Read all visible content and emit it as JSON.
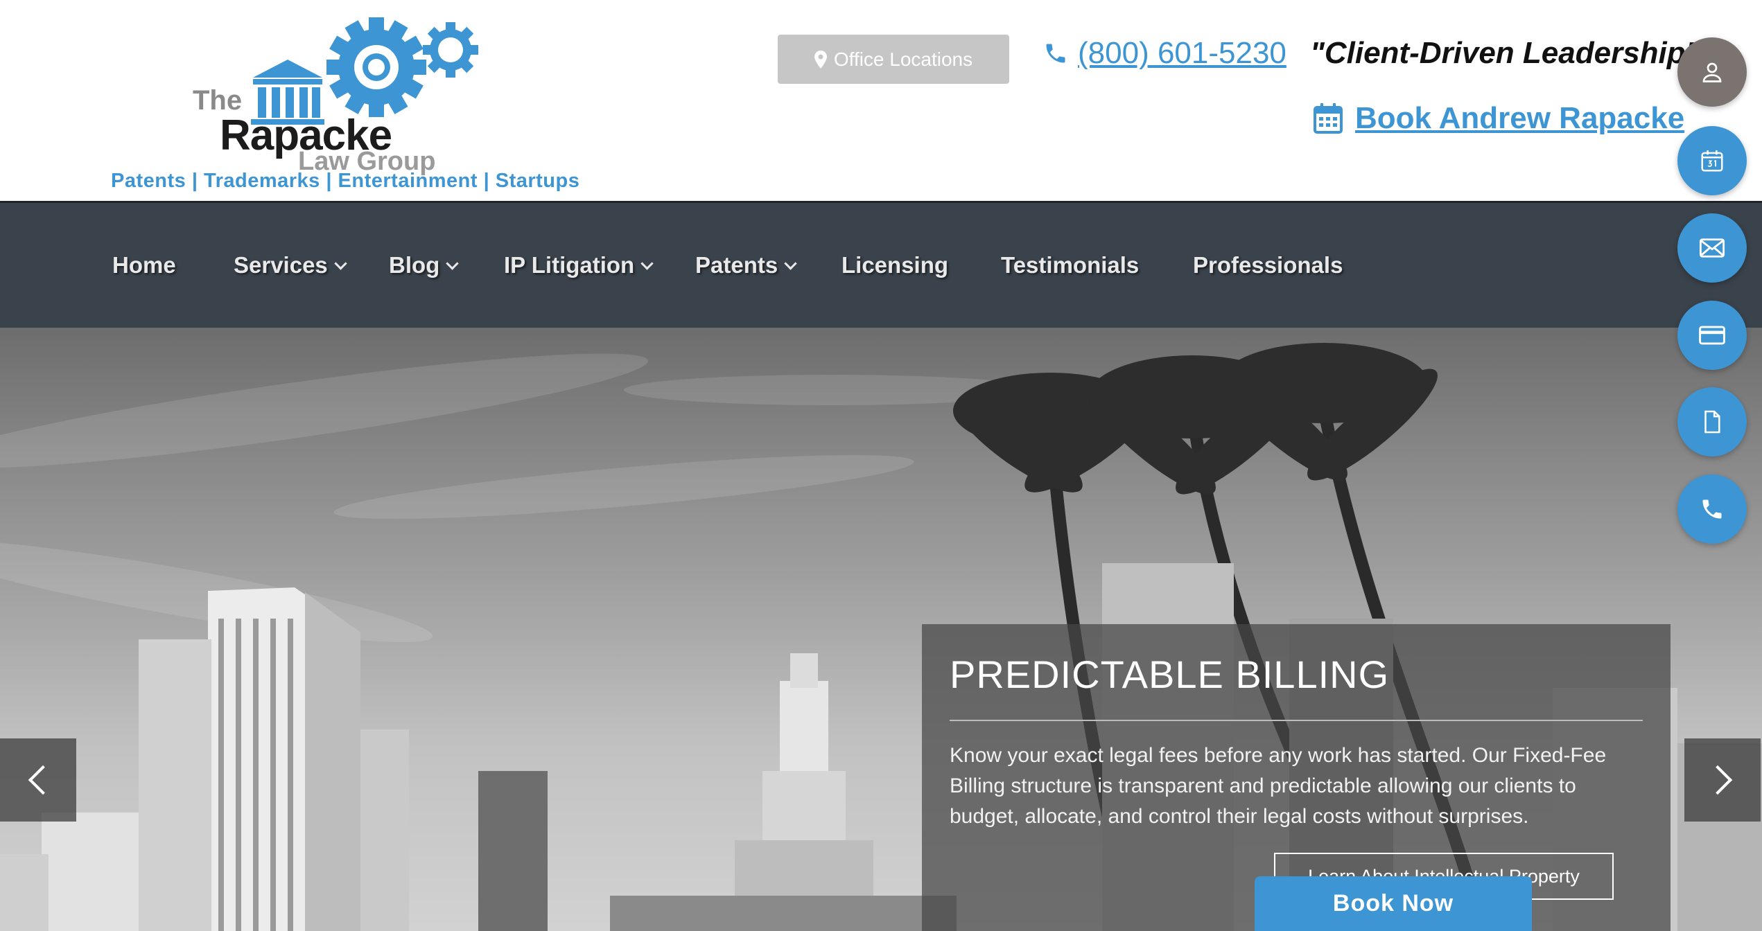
{
  "header": {
    "logo": {
      "the": "The",
      "name": "Rapacke",
      "sub": "Law Group"
    },
    "tagline": "Patents | Trademarks | Entertainment | Startups",
    "office_button": "Office Locations",
    "phone": "(800) 601-5230",
    "motto": "\"Client-Driven Leadership\"",
    "book_link": "Book Andrew Rapacke"
  },
  "nav": {
    "items": [
      {
        "label": "Home",
        "dropdown": false
      },
      {
        "label": "Services",
        "dropdown": true
      },
      {
        "label": "Blog",
        "dropdown": true
      },
      {
        "label": "IP Litigation",
        "dropdown": true
      },
      {
        "label": "Patents",
        "dropdown": true
      },
      {
        "label": "Licensing",
        "dropdown": false
      },
      {
        "label": "Testimonials",
        "dropdown": false
      },
      {
        "label": "Professionals",
        "dropdown": false
      }
    ]
  },
  "hero": {
    "title": "PREDICTABLE BILLING",
    "text": "Know your exact legal fees before any work has started. Our Fixed-Fee Billing structure is transparent and predictable allowing our clients to budget, allocate, and control their legal costs without surprises.",
    "button": "Learn About Intellectual Property",
    "book_now": "Book Now"
  },
  "side_buttons": [
    {
      "icon": "user-icon",
      "color": "#7a7370"
    },
    {
      "icon": "calendar-icon",
      "color": "#3d95d3"
    },
    {
      "icon": "envelope-icon",
      "color": "#3d95d3"
    },
    {
      "icon": "credit-card-icon",
      "color": "#3d95d3"
    },
    {
      "icon": "document-icon",
      "color": "#3d95d3"
    },
    {
      "icon": "phone-icon",
      "color": "#3d95d3"
    }
  ],
  "colors": {
    "accent": "#3d95d3",
    "nav_bg": "#3a424b"
  }
}
